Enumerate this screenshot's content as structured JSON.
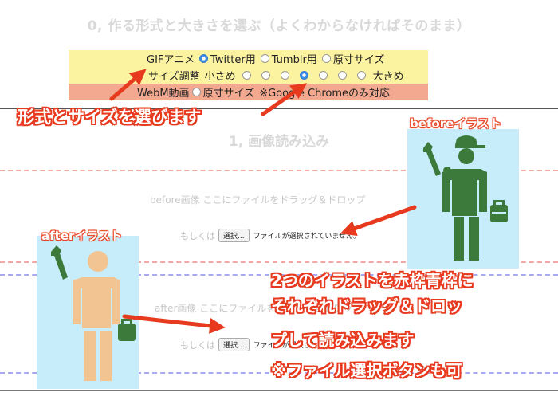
{
  "step0_title": "0, 作る形式と大きさを選ぶ（よくわからなければそのまま）",
  "gif": {
    "label": "GIFアニメ",
    "options": [
      "Twitter用",
      "Tumblr用",
      "原寸サイズ"
    ],
    "selected": "Twitter用"
  },
  "size": {
    "label": "サイズ調整",
    "min_label": "小さめ",
    "max_label": "大きめ",
    "steps": 7,
    "selected_step": 4
  },
  "webm": {
    "label": "WebM動画",
    "option": "原寸サイズ",
    "note": "※Google Chromeのみ対応"
  },
  "step1_title": "1, 画像読み込み",
  "before": {
    "drop_text": "before画像 ここにファイルをドラッグ＆ドロップ",
    "or_label": "もしくは",
    "button": "選択...",
    "status": "ファイルが選択されていません。"
  },
  "after": {
    "drop_text": "after画像 ここにファイルをドラッグ＆ドロップ",
    "or_label": "もしくは",
    "button": "選択...",
    "status": "ファイルが選択されていません。"
  },
  "annotations": {
    "format_callout": "形式とサイズを選びます",
    "before_illust_title": "beforeイラスト",
    "after_illust_title": "afterイラスト",
    "instruction_lines": [
      "2つのイラストを赤枠青枠に",
      "それぞれドラッグ＆ドロッ",
      "プして読み込みます",
      "※ファイル選択ボタンも可"
    ]
  },
  "colors": {
    "panel_yellow": "#fbf3a0",
    "panel_orange": "#f2a98f",
    "radio_blue": "#3a8ee6",
    "callout_red": "#e83a1f",
    "illust_bg": "#c7ecfa",
    "before_figure": "#3c7a3b",
    "after_figure": "#f2c492",
    "dash_red": "#f3a8a8",
    "dash_blue": "#a9a9f2"
  }
}
